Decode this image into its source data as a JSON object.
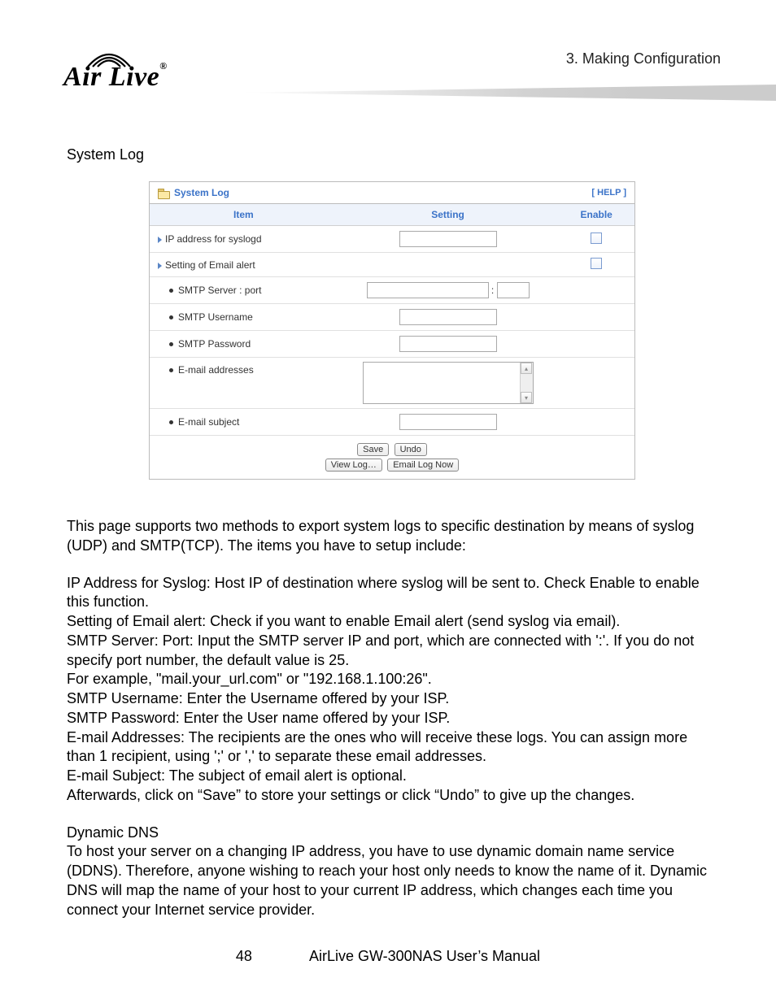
{
  "header": {
    "chapter": "3.  Making  Configuration",
    "logo_text": "Air Live"
  },
  "section_heading": "System Log",
  "panel": {
    "title": "System Log",
    "help": "[ HELP ]",
    "columns": {
      "item": "Item",
      "setting": "Setting",
      "enable": "Enable"
    },
    "rows": {
      "ip_syslogd": "IP address for syslogd",
      "email_alert": "Setting of Email alert",
      "smtp_server": "SMTP Server : port",
      "smtp_port_sep": ":",
      "smtp_user": "SMTP Username",
      "smtp_pass": "SMTP Password",
      "email_addr": "E-mail addresses",
      "email_subj": "E-mail subject"
    },
    "buttons": {
      "save": "Save",
      "undo": "Undo",
      "viewlog": "View Log…",
      "emailnow": "Email Log Now"
    }
  },
  "body": {
    "intro": "This page supports two methods to export system logs to specific destination by means of syslog (UDP) and SMTP(TCP). The items you have to setup include:",
    "lines": [
      "IP Address for Syslog: Host IP of destination where syslog will be sent to. Check Enable to enable this function.",
      "Setting of Email alert: Check if you want to enable Email alert (send syslog via email).",
      "SMTP Server: Port: Input the SMTP server IP and port, which are connected with ':'. If you do not specify port number, the default value is 25.",
      "For example, \"mail.your_url.com\" or \"192.168.1.100:26\".",
      "SMTP Username: Enter the Username offered by your ISP.",
      "SMTP Password: Enter the User name offered by your ISP.",
      "E-mail Addresses: The recipients are the ones who will receive these logs. You can assign more than 1 recipient, using ';' or ',' to separate these email addresses.",
      "E-mail Subject: The subject of email alert is optional.",
      "Afterwards, click on “Save” to store your settings or click “Undo” to give up the changes."
    ],
    "ddns_heading": "Dynamic DNS",
    "ddns_body": "To host your server on a changing IP address, you have to use dynamic domain name service (DDNS). Therefore, anyone wishing to reach your host only needs to know the name of it. Dynamic DNS will map the name of your host to your current IP address, which changes each time you connect your Internet service provider."
  },
  "footer": {
    "page": "48",
    "doc": "AirLive GW-300NAS User’s Manual"
  }
}
